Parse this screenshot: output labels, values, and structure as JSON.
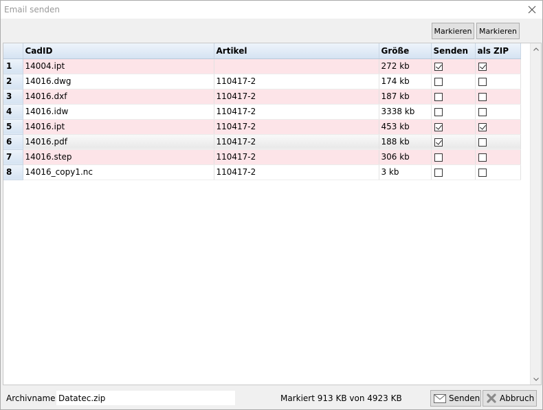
{
  "window": {
    "title": "Email senden"
  },
  "toolbar": {
    "mark_button_1": "Markieren",
    "mark_button_2": "Markieren"
  },
  "table": {
    "columns": [
      "CadID",
      "Artikel",
      "Größe",
      "Senden",
      "als ZIP"
    ],
    "rows": [
      {
        "num": "1",
        "cadid": "14004.ipt",
        "artikel": "",
        "groesse": "272 kb",
        "senden": true,
        "zip": true
      },
      {
        "num": "2",
        "cadid": "14016.dwg",
        "artikel": "110417-2",
        "groesse": "174 kb",
        "senden": false,
        "zip": false
      },
      {
        "num": "3",
        "cadid": "14016.dxf",
        "artikel": "110417-2",
        "groesse": "187 kb",
        "senden": false,
        "zip": false
      },
      {
        "num": "4",
        "cadid": "14016.idw",
        "artikel": "110417-2",
        "groesse": "3338 kb",
        "senden": false,
        "zip": false
      },
      {
        "num": "5",
        "cadid": "14016.ipt",
        "artikel": "110417-2",
        "groesse": "453 kb",
        "senden": true,
        "zip": true
      },
      {
        "num": "6",
        "cadid": "14016.pdf",
        "artikel": "110417-2",
        "groesse": "188 kb",
        "senden": true,
        "zip": false
      },
      {
        "num": "7",
        "cadid": "14016.step",
        "artikel": "110417-2",
        "groesse": "306 kb",
        "senden": false,
        "zip": false
      },
      {
        "num": "8",
        "cadid": "14016_copy1.nc",
        "artikel": "110417-2",
        "groesse": "3 kb",
        "senden": false,
        "zip": false
      }
    ],
    "selected_row": 5
  },
  "footer": {
    "archive_label": "Archivname:",
    "archive_value": "Datatec.zip",
    "status": "Markiert 913 KB von 4923 KB",
    "send_label": "Senden",
    "cancel_label": "Abbruch"
  },
  "colors": {
    "row_alt": "#fde4e8",
    "header": "#d5e3f2"
  }
}
